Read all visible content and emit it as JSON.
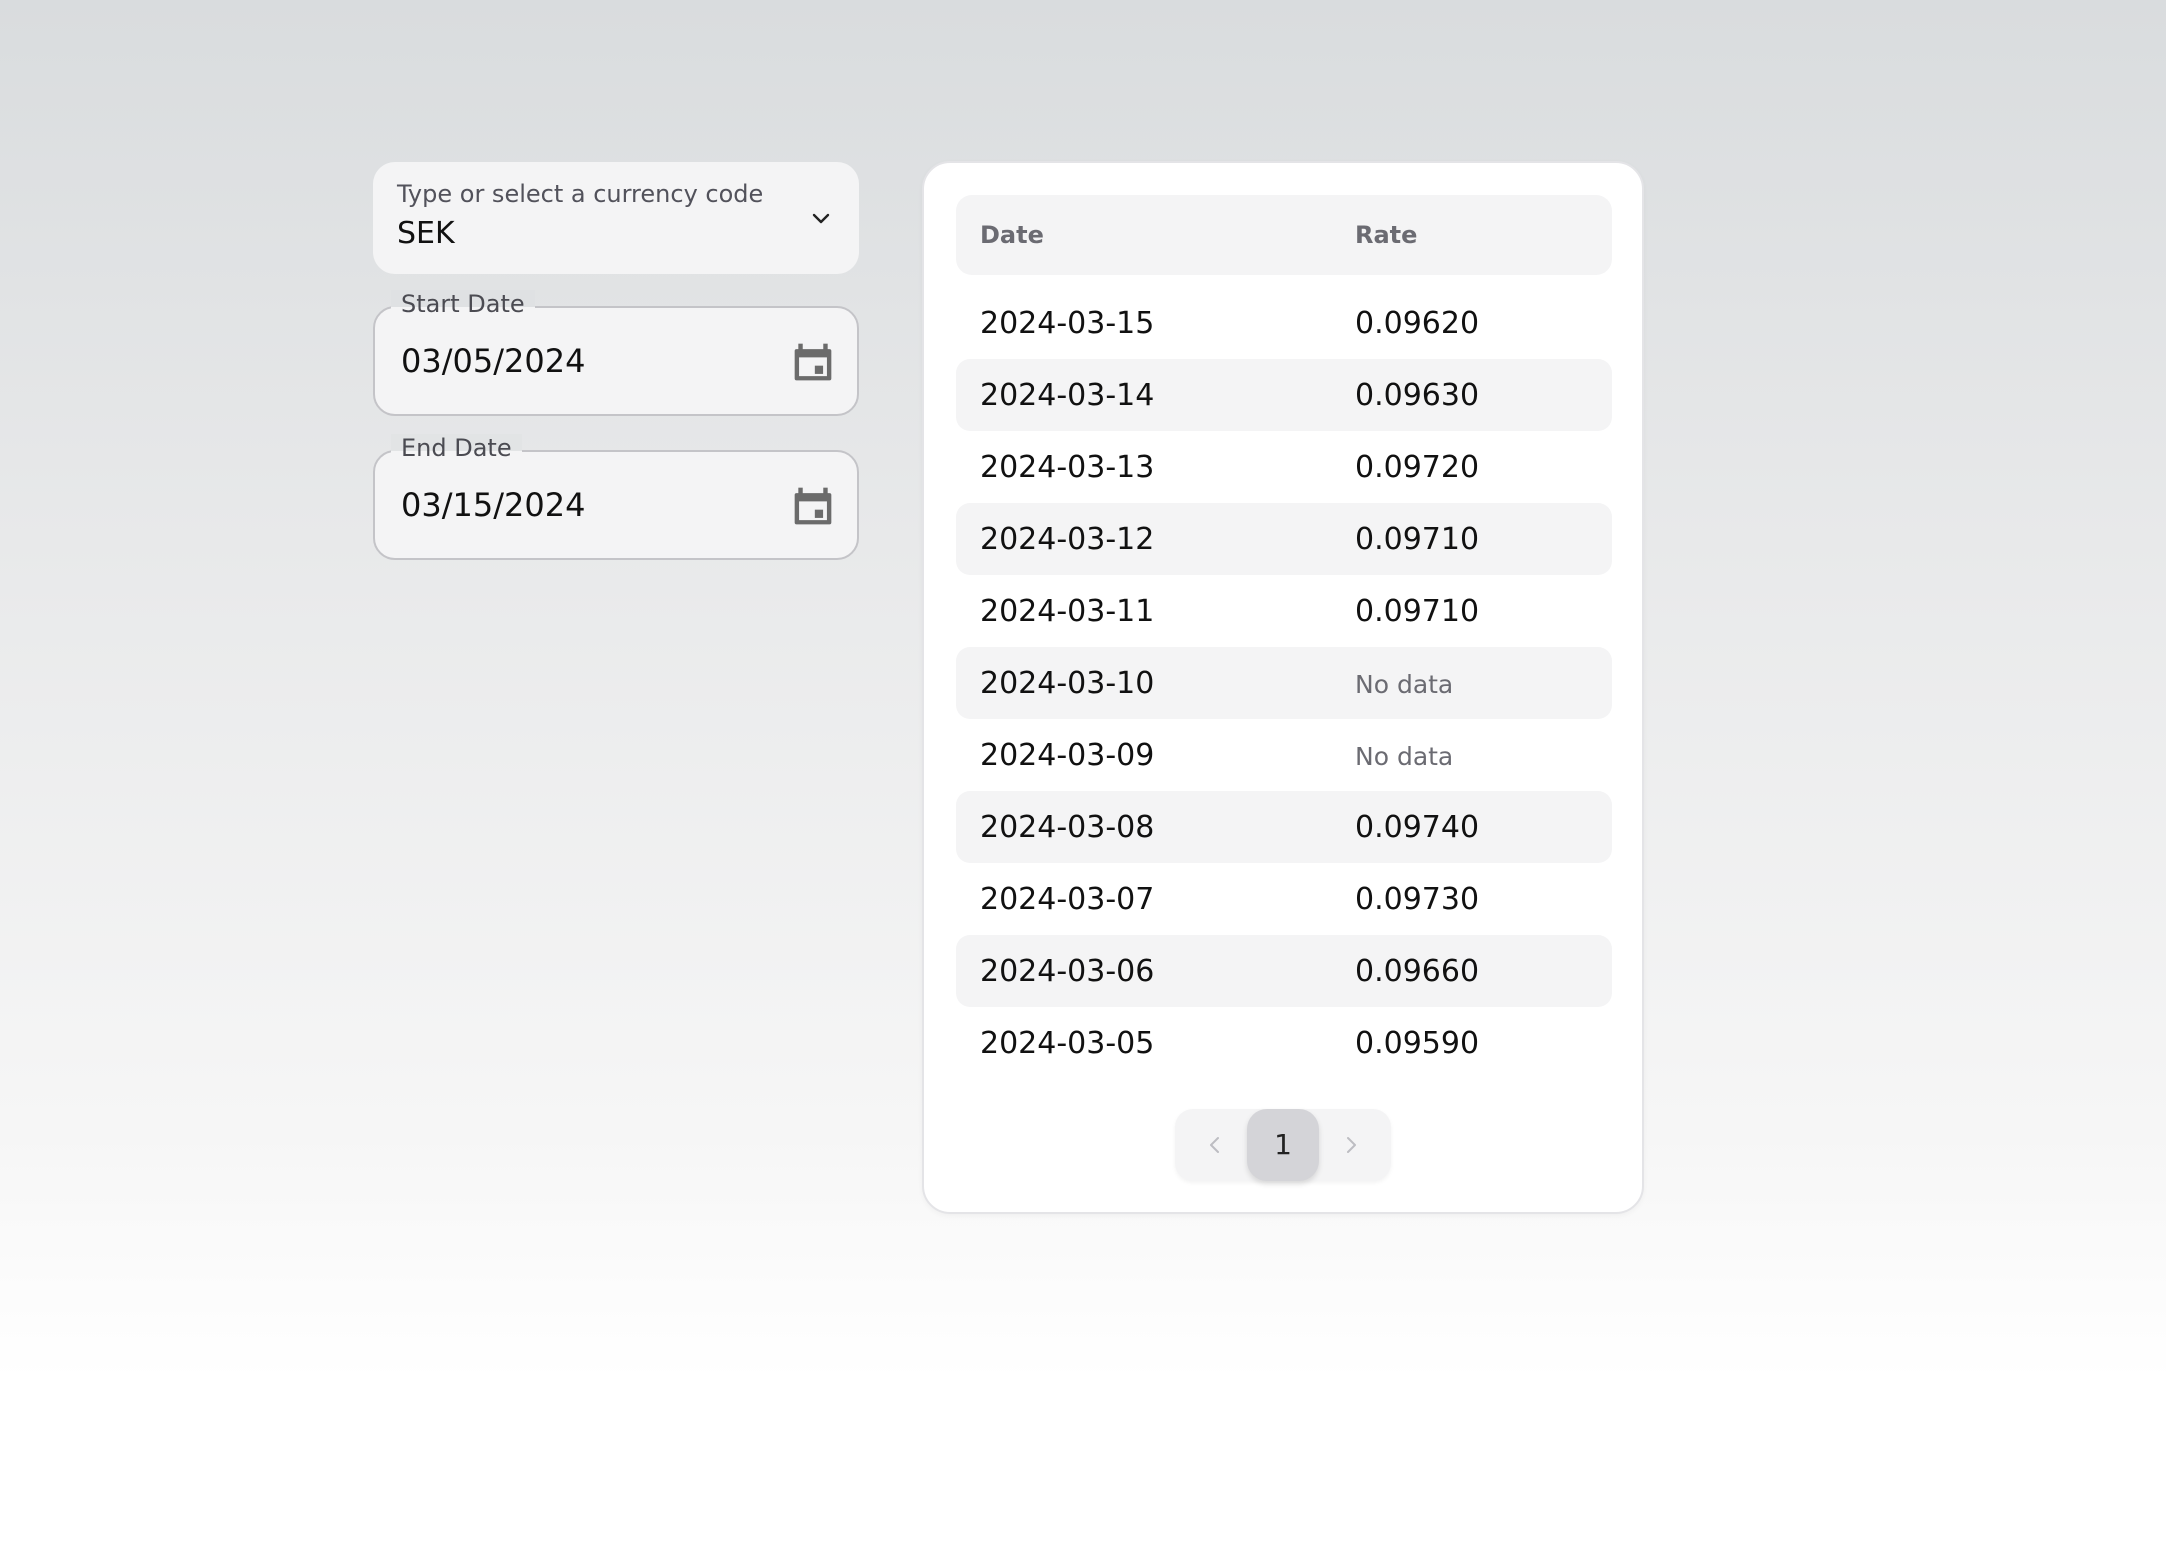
{
  "currency": {
    "label": "Type or select a currency code",
    "value": "SEK",
    "icon": "chevron-down-icon"
  },
  "start_date": {
    "label": "Start Date",
    "value": "03/05/2024",
    "icon": "calendar-icon"
  },
  "end_date": {
    "label": "End Date",
    "value": "03/15/2024",
    "icon": "calendar-icon"
  },
  "table": {
    "headers": [
      "Date",
      "Rate"
    ],
    "rows": [
      {
        "date": "2024-03-15",
        "rate": "0.09620"
      },
      {
        "date": "2024-03-14",
        "rate": "0.09630"
      },
      {
        "date": "2024-03-13",
        "rate": "0.09720"
      },
      {
        "date": "2024-03-12",
        "rate": "0.09710"
      },
      {
        "date": "2024-03-11",
        "rate": "0.09710"
      },
      {
        "date": "2024-03-10",
        "rate": "No data"
      },
      {
        "date": "2024-03-09",
        "rate": "No data"
      },
      {
        "date": "2024-03-08",
        "rate": "0.09740"
      },
      {
        "date": "2024-03-07",
        "rate": "0.09730"
      },
      {
        "date": "2024-03-06",
        "rate": "0.09660"
      },
      {
        "date": "2024-03-05",
        "rate": "0.09590"
      }
    ]
  },
  "pagination": {
    "current_page": "1",
    "prev_icon": "chevron-left-icon",
    "next_icon": "chevron-right-icon"
  },
  "colors": {
    "background_top": "#d9dcde",
    "background_bottom": "#ffffff",
    "field_fill": "#f4f4f5",
    "active_page": "#d4d4d8",
    "muted_text": "#6b6b72"
  }
}
